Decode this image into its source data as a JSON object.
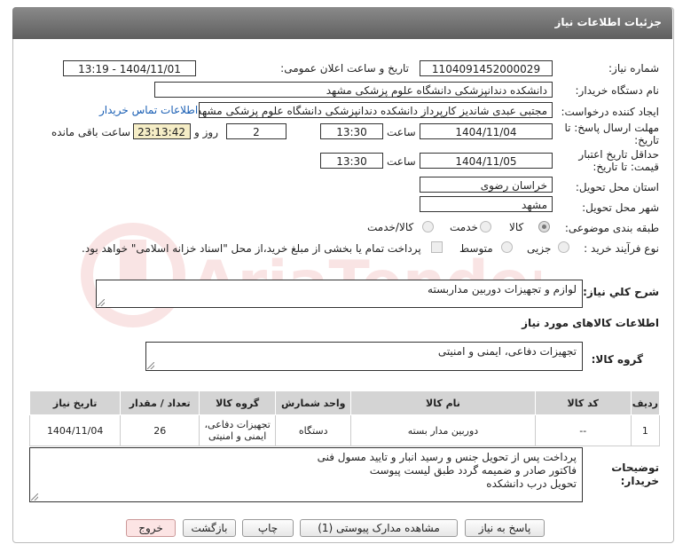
{
  "header": {
    "title": "جزئیات اطلاعات نیاز"
  },
  "labels": {
    "need_number": "شماره نیاز:",
    "announce_datetime": "تاریخ و ساعت اعلان عمومی:",
    "buyer_org": "نام دستگاه خریدار:",
    "requester": "ایجاد کننده درخواست:",
    "reply_deadline_l1": "مهلت ارسال پاسخ: تا",
    "reply_deadline_l2": "تاریخ:",
    "time": "ساعت",
    "day_and": "روز و",
    "remaining": "ساعت باقی مانده",
    "price_validity_l1": "حداقل تاریخ اعتبار",
    "price_validity_l2": "قیمت: تا تاریخ:",
    "province": "استان محل تحویل:",
    "city": "شهر محل تحویل:",
    "category": "طبقه بندی موضوعی:",
    "process_type": "نوع فرآیند خرید :",
    "general_desc": "شرح کلي نياز:",
    "goods_info": "اطلاعات کالاهای مورد نیاز",
    "goods_group": "گروه کالا:",
    "buyer_notes_l1": "توضیحات",
    "buyer_notes_l2": "خریدار:"
  },
  "values": {
    "need_number": "1104091452000029",
    "announce_datetime": "1404/11/01 - 13:19",
    "buyer_org": "دانشکده دندانپزشکی   دانشگاه علوم پزشکی مشهد",
    "requester": "مجتبی عبدی شاندیز کارپرداز دانشکده دندانپزشکی   دانشگاه علوم پزشکی مشهد",
    "contact_link": "اطلاعات تماس خریدار",
    "reply_date": "1404/11/04",
    "reply_time": "13:30",
    "days": "2",
    "remaining_time": "23:13:42",
    "validity_date": "1404/11/05",
    "validity_time": "13:30",
    "province": "خراسان رضوی",
    "city": "مشهد",
    "general_desc": "لوازم و تجهیزات دوربین مداربسته",
    "goods_group": "تجهیزات دفاعی، ایمنی و امنیتی",
    "buyer_notes": [
      "پرداخت پس از تحویل جنس و رسید انبار و تایید مسول فنی",
      "فاکتور صادر و ضمیمه گردد طبق لیست پیوست",
      "تحویل درب دانشکده"
    ]
  },
  "category_options": [
    "کالا",
    "خدمت",
    "کالا/خدمت"
  ],
  "category_selected": "کالا",
  "process_options": [
    "جزیی",
    "متوسط"
  ],
  "payment_note": "پرداخت تمام یا بخشی از مبلغ خرید،از محل \"اسناد خزانه اسلامی\" خواهد بود.",
  "table": {
    "headers": [
      "ردیف",
      "کد کالا",
      "نام کالا",
      "واحد شمارش",
      "گروه کالا",
      "تعداد / مقدار",
      "تاریخ نیاز"
    ],
    "rows": [
      [
        "1",
        "--",
        "دوربین مدار بسته",
        "دستگاه",
        "تجهیزات دفاعی، ایمنی و امنیتی",
        "26",
        "1404/11/04"
      ]
    ]
  },
  "buttons": {
    "reply": "پاسخ به نیاز",
    "view_docs": "مشاهده مدارک پیوستی (1)",
    "print": "چاپ",
    "back": "بازگشت",
    "exit": "خروج"
  },
  "watermark": "AriaTender.net",
  "colors": {
    "header_bg": "#6f6f6f",
    "remaining_bg": "#f5edc6",
    "link": "#1a5fb4",
    "exit_bg": "#fce4e4"
  }
}
